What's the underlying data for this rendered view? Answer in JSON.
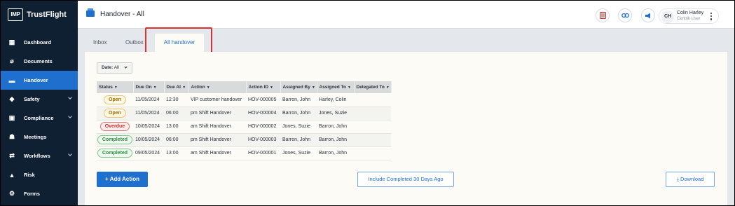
{
  "brand": {
    "logo_mark": "IMP",
    "name": "TrustFlight"
  },
  "sidebar": {
    "items": [
      {
        "label": "Dashboard",
        "icon": "dashboard-icon",
        "glyph": "▦",
        "active": false,
        "expandable": false
      },
      {
        "label": "Documents",
        "icon": "paperclip-icon",
        "glyph": "⌀",
        "active": false,
        "expandable": false
      },
      {
        "label": "Handover",
        "icon": "handover-icon",
        "glyph": "▬",
        "active": true,
        "expandable": false
      },
      {
        "label": "Safety",
        "icon": "shield-icon",
        "glyph": "◆",
        "active": false,
        "expandable": true
      },
      {
        "label": "Compliance",
        "icon": "compliance-icon",
        "glyph": "▣",
        "active": false,
        "expandable": true
      },
      {
        "label": "Meetings",
        "icon": "meetings-icon",
        "glyph": "☗",
        "active": false,
        "expandable": false
      },
      {
        "label": "Workflows",
        "icon": "workflows-icon",
        "glyph": "⇄",
        "active": false,
        "expandable": true
      },
      {
        "label": "Risk",
        "icon": "risk-icon",
        "glyph": "▲",
        "active": false,
        "expandable": false
      },
      {
        "label": "Forms",
        "icon": "forms-icon",
        "glyph": "⚙",
        "active": false,
        "expandable": false
      }
    ]
  },
  "header": {
    "title": "Handover - All",
    "user": {
      "initials": "CH",
      "name": "Colin Harley",
      "role": "Centrik User"
    }
  },
  "tabs": [
    {
      "label": "Inbox"
    },
    {
      "label": "Outbox"
    },
    {
      "label": "All handover",
      "active": true
    }
  ],
  "filter": {
    "label": "Date:",
    "value": "All"
  },
  "table": {
    "columns": [
      "Status",
      "Due On",
      "Due At",
      "Action",
      "Action ID",
      "Assigned By",
      "Assigned To",
      "Delegated To"
    ],
    "rows": [
      {
        "status": "Open",
        "status_kind": "open",
        "due_on": "11/05/2024",
        "due_at": "12:30",
        "action": "VIP customer handover",
        "action_id": "HOV-000005",
        "assigned_by": "Barron, John",
        "assigned_to": "Harley, Colin",
        "delegated_to": ""
      },
      {
        "status": "Open",
        "status_kind": "open",
        "due_on": "11/05/2024",
        "due_at": "06:00",
        "action": "pm Shift Handover",
        "action_id": "HOV-000004",
        "assigned_by": "Barron, John",
        "assigned_to": "Jones, Suzie",
        "delegated_to": ""
      },
      {
        "status": "Overdue",
        "status_kind": "overdue",
        "due_on": "10/05/2024",
        "due_at": "13:00",
        "action": "am Shift Handover",
        "action_id": "HOV-000002",
        "assigned_by": "Jones, Suzie",
        "assigned_to": "Barron, John",
        "delegated_to": ""
      },
      {
        "status": "Completed",
        "status_kind": "completed",
        "due_on": "10/05/2024",
        "due_at": "06:00",
        "action": "pm Shift Handover",
        "action_id": "HOV-000003",
        "assigned_by": "Barron, John",
        "assigned_to": "Barron, John",
        "delegated_to": ""
      },
      {
        "status": "Completed",
        "status_kind": "completed",
        "due_on": "09/05/2024",
        "due_at": "13:00",
        "action": "am Shift Handover",
        "action_id": "HOV-000001",
        "assigned_by": "Jones, Suzie",
        "assigned_to": "Barron, John",
        "delegated_to": ""
      }
    ]
  },
  "actions": {
    "add": "+ Add Action",
    "include_completed": "Include Completed 30 Days Ago",
    "download": "Download",
    "download_glyph": "⤓"
  },
  "colors": {
    "sidebar_bg": "#0f2033",
    "accent": "#1f6fcf",
    "highlight": "#e03131"
  }
}
